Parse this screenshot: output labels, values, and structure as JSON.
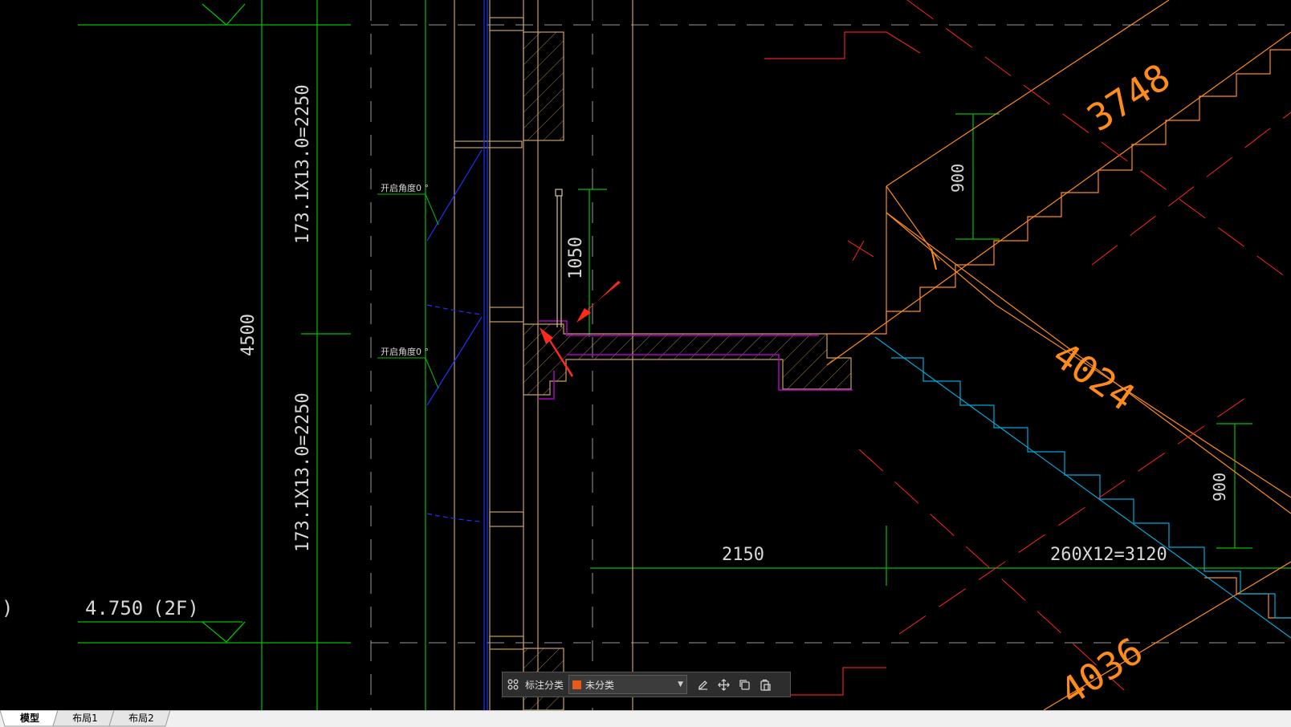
{
  "drawing": {
    "dimensions": {
      "height_total": "4500",
      "riser_upper": "173.1X13.0=2250",
      "riser_lower": "173.1X13.0=2250",
      "landing_rail": "1050",
      "landing_width": "2150",
      "tread_run": "260X12=3120",
      "guard_upper": "900",
      "guard_lower": "900",
      "flight_upper_len": "3748",
      "flight_mid_len": "4024",
      "flight_lower_len": "4036"
    },
    "notes": {
      "door_open_1": "开启角度0 °",
      "door_open_2": "开启角度0 °"
    },
    "level": {
      "elevation": "4.750",
      "floor": "(2F)",
      "left_stub": ")"
    },
    "colors": {
      "background": "#000000",
      "dimension": "#00c000",
      "wall": "#c8a060",
      "stair": "#ff8c1a",
      "slab_outline": "#b000c8",
      "axis": "#ff2020",
      "stair_outline_blue": "#00a8d8",
      "window": "#2030ff",
      "annotation_arrow": "#ff2a1a"
    }
  },
  "toolbar": {
    "grid_icon": "grid-icon",
    "label": "标注分类",
    "select_value": "未分类",
    "select_color": "#e8591a",
    "edit_icon": "edit-icon",
    "move_icon": "move-icon",
    "copy_icon": "copy-icon",
    "paste_icon": "paste-icon"
  },
  "tabs": [
    {
      "label": "模型",
      "active": true
    },
    {
      "label": "布局1",
      "active": false
    },
    {
      "label": "布局2",
      "active": false
    }
  ]
}
